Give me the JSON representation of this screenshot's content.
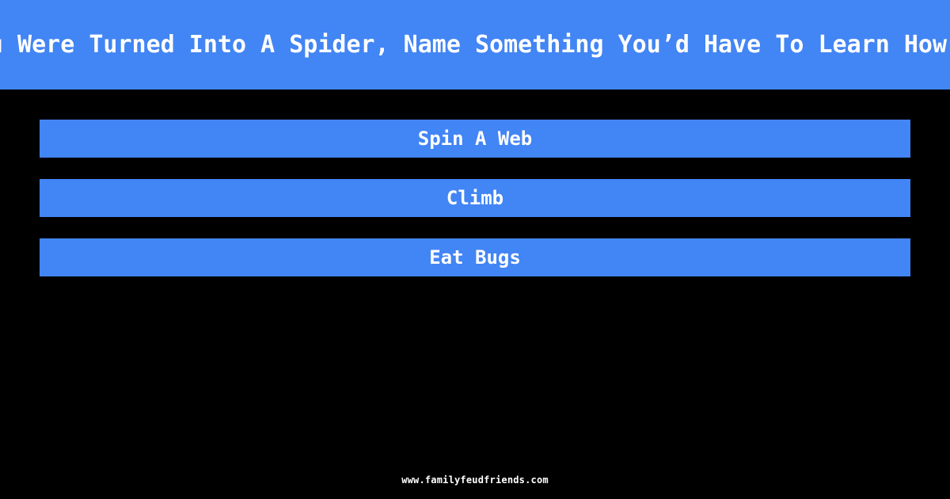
{
  "meta": {
    "background_color": "#000000",
    "accent_color": "#4285f4",
    "text_color": "#ffffff"
  },
  "header": {
    "question": "If You Were Turned Into A Spider, Name Something You’d Have To Learn How To Do",
    "banner_color": "#4285f4"
  },
  "answers": [
    {
      "rank": 1,
      "text": "Spin A Web"
    },
    {
      "rank": 2,
      "text": "Climb"
    },
    {
      "rank": 3,
      "text": "Eat Bugs"
    }
  ],
  "footer": {
    "site": "www.familyfeudfriends.com"
  }
}
